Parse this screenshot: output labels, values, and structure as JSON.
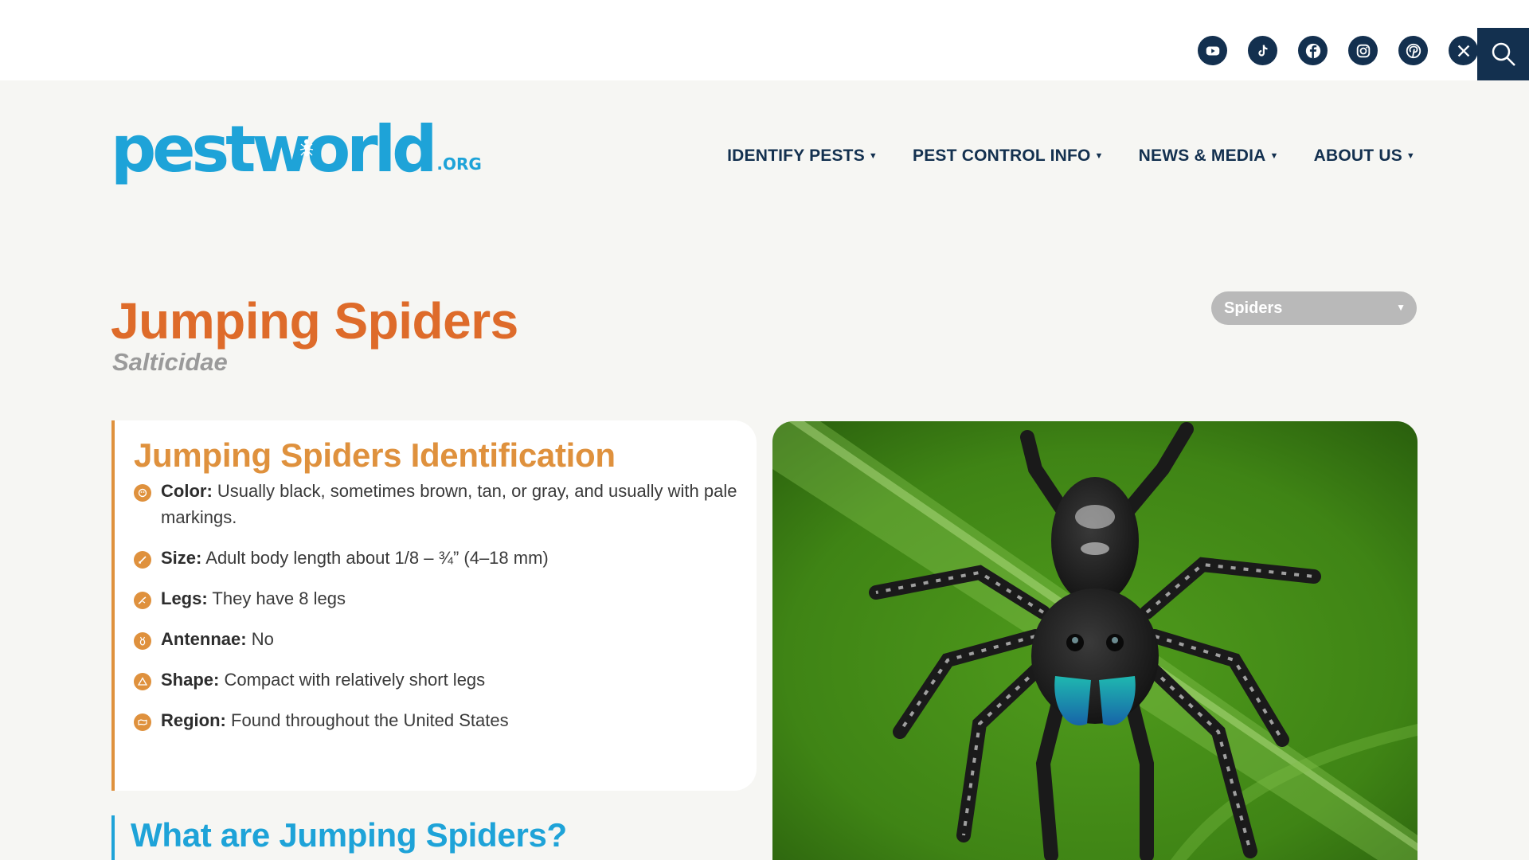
{
  "social": [
    {
      "name": "youtube-icon",
      "label": "YouTube"
    },
    {
      "name": "tiktok-icon",
      "label": "TikTok"
    },
    {
      "name": "facebook-icon",
      "label": "Facebook"
    },
    {
      "name": "instagram-icon",
      "label": "Instagram"
    },
    {
      "name": "pinterest-icon",
      "label": "Pinterest"
    },
    {
      "name": "x-icon",
      "label": "X"
    }
  ],
  "logo": {
    "word": "pestworld",
    "tld": ".ORG"
  },
  "nav": [
    {
      "label": "IDENTIFY PESTS"
    },
    {
      "label": "PEST CONTROL INFO"
    },
    {
      "label": "NEWS & MEDIA"
    },
    {
      "label": "ABOUT US"
    }
  ],
  "page": {
    "title": "Jumping Spiders",
    "scientific_name": "Salticidae",
    "category_select": "Spiders"
  },
  "identification": {
    "title": "Jumping Spiders Identification",
    "items": [
      {
        "label": "Color:",
        "value": "Usually black, sometimes brown, tan, or gray, and usually with pale markings.",
        "icon": "color-icon"
      },
      {
        "label": "Size:",
        "value": "Adult body length about 1/8 – ¾” (4–18 mm)",
        "icon": "size-icon"
      },
      {
        "label": "Legs:",
        "value": "They have 8 legs",
        "icon": "legs-icon"
      },
      {
        "label": "Antennae:",
        "value": "No",
        "icon": "antennae-icon"
      },
      {
        "label": "Shape:",
        "value": "Compact with relatively short legs",
        "icon": "shape-icon"
      },
      {
        "label": "Region:",
        "value": "Found throughout the United States",
        "icon": "region-icon"
      }
    ]
  },
  "section2": {
    "title": "What are Jumping Spiders?"
  },
  "colors": {
    "navy": "#13304f",
    "brand_blue": "#1ea3d8",
    "title_orange": "#de6b2a",
    "accent_orange": "#df913d"
  }
}
